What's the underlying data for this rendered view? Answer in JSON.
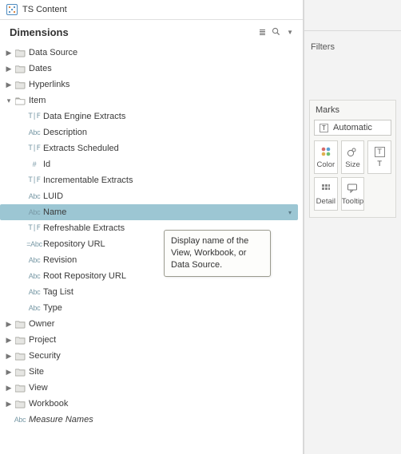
{
  "header": {
    "datasource": "TS Content"
  },
  "dimensions_title": "Dimensions",
  "tooltip_text": "Display name of the View, Workbook, or Data Source.",
  "tree": {
    "data_source": "Data Source",
    "dates": "Dates",
    "hyperlinks": "Hyperlinks",
    "item": "Item",
    "item_children": {
      "data_engine_extracts": "Data Engine Extracts",
      "description": "Description",
      "extracts_scheduled": "Extracts Scheduled",
      "id": "Id",
      "incrementable_extracts": "Incrementable Extracts",
      "luid": "LUID",
      "name": "Name",
      "refreshable_extracts": "Refreshable Extracts",
      "repository_url": "Repository URL",
      "revision": "Revision",
      "root_repository_url": "Root Repository URL",
      "tag_list": "Tag List",
      "type": "Type"
    },
    "owner": "Owner",
    "project": "Project",
    "security": "Security",
    "site": "Site",
    "view": "View",
    "workbook": "Workbook",
    "measure_names": "Measure Names"
  },
  "type_icons": {
    "tf": "T|F",
    "abc": "Abc",
    "hash": "#",
    "eqabc": "=Abc"
  },
  "right": {
    "filters": "Filters",
    "marks": "Marks",
    "automatic": "Automatic",
    "color": "Color",
    "size": "Size",
    "text": "T",
    "detail": "Detail",
    "tooltip": "Tooltip"
  }
}
